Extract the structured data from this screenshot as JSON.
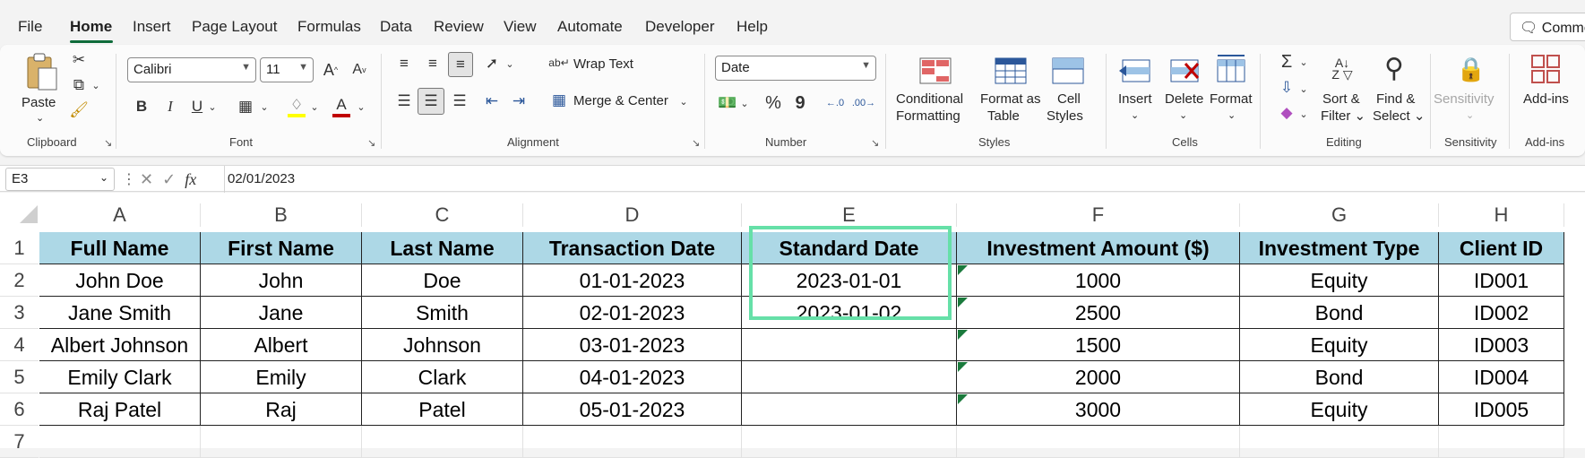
{
  "menu": {
    "items": [
      "File",
      "Home",
      "Insert",
      "Page Layout",
      "Formulas",
      "Data",
      "Review",
      "View",
      "Automate",
      "Developer",
      "Help"
    ],
    "active": "Home",
    "comments": "Comme"
  },
  "ribbon": {
    "clipboard": {
      "paste": "Paste",
      "group": "Clipboard"
    },
    "font": {
      "name": "Calibri",
      "size": "11",
      "group": "Font",
      "bold": "B",
      "italic": "I",
      "underline": "U"
    },
    "alignment": {
      "wrap": "Wrap Text",
      "merge": "Merge & Center",
      "group": "Alignment"
    },
    "number": {
      "format": "Date",
      "group": "Number",
      "percent": "%",
      "comma": "9"
    },
    "styles": {
      "conditional": "Conditional",
      "conditional2": "Formatting",
      "format_table": "Format as",
      "format_table2": "Table",
      "cell_styles": "Cell",
      "cell_styles2": "Styles",
      "group": "Styles"
    },
    "cells": {
      "insert": "Insert",
      "delete": "Delete",
      "format": "Format",
      "group": "Cells"
    },
    "editing": {
      "sort": "Sort &",
      "sort2": "Filter",
      "find": "Find &",
      "find2": "Select",
      "group": "Editing"
    },
    "sensitivity": {
      "label": "Sensitivity",
      "group": "Sensitivity"
    },
    "addins": {
      "label": "Add-ins",
      "group": "Add-ins"
    },
    "colors": {
      "accent": "#0f6c3b",
      "font_color": "#c00000",
      "highlight": "#ffff00"
    }
  },
  "formula_bar": {
    "name_box": "E3",
    "fx": "fx",
    "value": "02/01/2023"
  },
  "sheet": {
    "columns": [
      "A",
      "B",
      "C",
      "D",
      "E",
      "F",
      "G",
      "H"
    ],
    "rows": [
      "1",
      "2",
      "3",
      "4",
      "5",
      "6",
      "7"
    ],
    "header": [
      "Full Name",
      "First Name",
      "Last Name",
      "Transaction Date",
      "Standard Date",
      "Investment Amount ($)",
      "Investment Type",
      "Client ID"
    ],
    "data": [
      [
        "John Doe",
        "John",
        "Doe",
        "01-01-2023",
        "2023-01-01",
        "1000",
        "Equity",
        "ID001"
      ],
      [
        "Jane Smith",
        "Jane",
        "Smith",
        "02-01-2023",
        "2023-01-02",
        "2500",
        "Bond",
        "ID002"
      ],
      [
        "Albert Johnson",
        "Albert",
        "Johnson",
        "03-01-2023",
        "",
        "1500",
        "Equity",
        "ID003"
      ],
      [
        "Emily Clark",
        "Emily",
        "Clark",
        "04-01-2023",
        "",
        "2000",
        "Bond",
        "ID004"
      ],
      [
        "Raj Patel",
        "Raj",
        "Patel",
        "05-01-2023",
        "",
        "3000",
        "Equity",
        "ID005"
      ]
    ],
    "header_fill": "#add8e6",
    "selection_color": "#66e0a8"
  }
}
